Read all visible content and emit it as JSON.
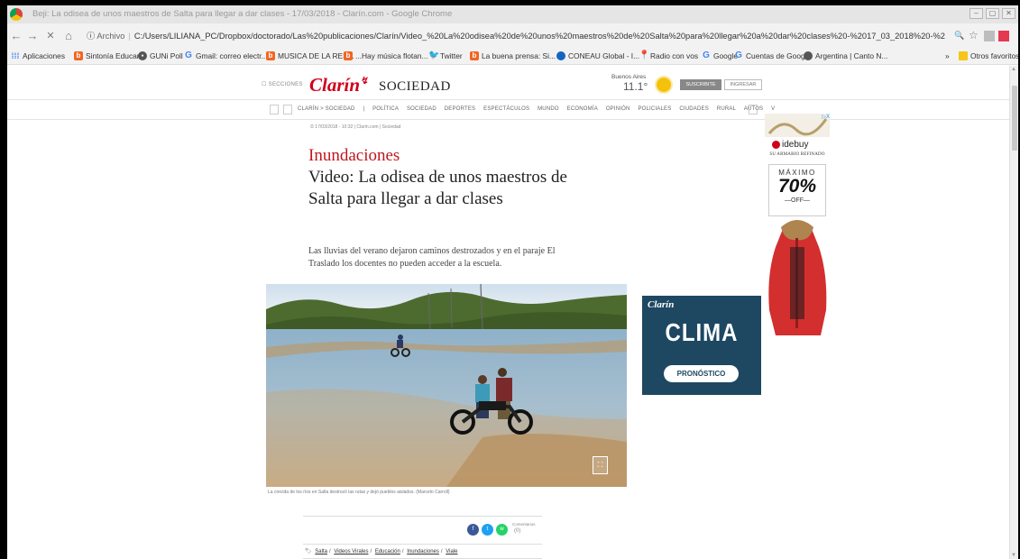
{
  "window": {
    "title": "Beji: La odisea de unos maestros de Salta para llegar a dar clases - 17/03/2018 - Clarín.com - Google Chrome",
    "controls": {
      "minimize": "–",
      "maximize": "▢",
      "close": "✕"
    }
  },
  "addressbar": {
    "nav": {
      "back": "←",
      "forward": "→",
      "reload": "✕",
      "home": "⌂"
    },
    "info_icon": "ⓘ",
    "scheme_label": "Archivo",
    "url": "C:/Users/LILIANA_PC/Dropbox/doctorado/Las%20publicaciones/Clarín/Video_%20La%20odisea%20de%20unos%20maestros%20de%20Salta%20para%20llegar%20a%20dar%20clases%20-%2017_03_2018%20-%20Clarín.com.html",
    "zoom_icon": "🔍",
    "star_icon": "☆",
    "account_icon": "●",
    "menu_icon": "⋮"
  },
  "bookmarks": {
    "apps_label": "Aplicaciones",
    "items": [
      {
        "label": "Sintonía Educar",
        "icon": "b"
      },
      {
        "label": "GUNi Poll",
        "icon": "●"
      },
      {
        "label": "Gmail: correo electr...",
        "icon": "G"
      },
      {
        "label": "MUSICA DE LA RES...",
        "icon": "b"
      },
      {
        "label": "...Hay música flotan...",
        "icon": "b"
      },
      {
        "label": "Twitter",
        "icon": "🐦"
      },
      {
        "label": "La buena prensa: Si...",
        "icon": "b"
      },
      {
        "label": "CONEAU Global - I...",
        "icon": "●"
      },
      {
        "label": "Radio con vos",
        "icon": "📍"
      },
      {
        "label": "Google",
        "icon": "G"
      },
      {
        "label": "Cuentas de Google",
        "icon": "G"
      },
      {
        "label": "Argentina | Canto N...",
        "icon": "●"
      }
    ],
    "more": "»",
    "other_label": "Otros favoritos"
  },
  "site": {
    "secciones": "SECCIONES",
    "logo": "Clarín",
    "section": "SOCIEDAD",
    "weather_city": "Buenos Aires",
    "weather_temp": "11.1°",
    "subscribe": "SUSCRIBITE",
    "login": "INGRESAR",
    "nav_links": [
      "CLARÍN > SOCIEDAD",
      "|",
      "POLÍTICA",
      "SOCIEDAD",
      "DEPORTES",
      "ESPECTÁCULOS",
      "MUNDO",
      "ECONOMÍA",
      "OPINIÓN",
      "POLICIALES",
      "CIUDADES",
      "RURAL",
      "AUTOS",
      "V"
    ]
  },
  "article": {
    "meta": "⏱ 17/03/2018 - 10:32 | Clarín.com | Sociedad",
    "kicker": "Inundaciones",
    "headline": "Video: La odisea de unos maestros de Salta para llegar a dar clases",
    "lead": "Las lluvias del verano dejaron caminos destrozados y en el paraje El Traslado los docentes no pueden acceder a la escuela.",
    "caption": "La crecida de los ríos en Salta destrozó las rutas y dejó pueblos aislados. (Marcelo Carroll)",
    "comments_label": "Comentarios",
    "comments_count": "(0)",
    "tags_prefix": "🏷",
    "tags": [
      "Salta",
      "Videos Virales",
      "Educación",
      "Inundaciones",
      "Viale"
    ]
  },
  "ads": {
    "clima": {
      "brand": "Clarín",
      "word": "CLIMA",
      "button": "PRONÓSTICO"
    },
    "side": {
      "brand": "idebuy",
      "tagline": "SU ARMARIO REFINADO",
      "max": "MÁXIMO",
      "pct": "70%",
      "off": "—OFF—",
      "x": "▷X"
    }
  },
  "colors": {
    "clarin_red": "#d0021b",
    "kicker_red": "#c0171e",
    "clima_bg": "#1e4862"
  }
}
